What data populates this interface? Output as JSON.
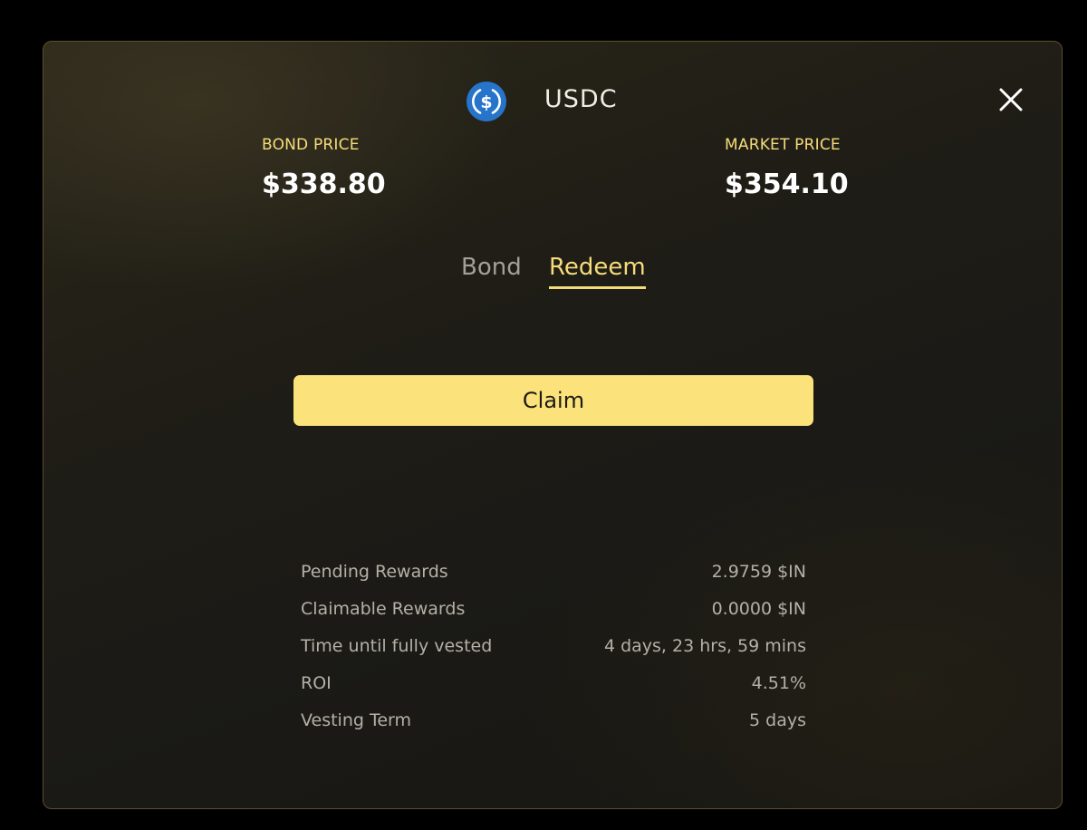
{
  "token": {
    "name": "USDC",
    "icon": "usdc-coin-icon",
    "icon_color": "#2775ca"
  },
  "prices": {
    "bond_label": "BOND PRICE",
    "bond_value": "$338.80",
    "market_label": "MARKET PRICE",
    "market_value": "$354.10"
  },
  "tabs": [
    {
      "label": "Bond",
      "active": false
    },
    {
      "label": "Redeem",
      "active": true
    }
  ],
  "claim_button": {
    "label": "Claim"
  },
  "stats": [
    {
      "label": "Pending Rewards",
      "value": "2.9759 $IN"
    },
    {
      "label": "Claimable Rewards",
      "value": "0.0000 $IN"
    },
    {
      "label": "Time until fully vested",
      "value": "4 days, 23 hrs, 59 mins"
    },
    {
      "label": "ROI",
      "value": "4.51%"
    },
    {
      "label": "Vesting Term",
      "value": "5 days"
    }
  ],
  "colors": {
    "accent": "#f5dc7a",
    "button": "#fbe27b",
    "background": "#1e1c16",
    "border": "#5c4f2a"
  }
}
